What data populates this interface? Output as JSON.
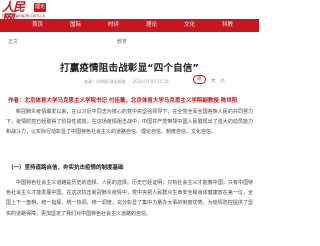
{
  "site": {
    "logo_text": "人民网",
    "logo_domain": "theory.people.com.cn",
    "badge": "理论"
  },
  "nav": {
    "items": [
      "首页",
      "国际",
      "时评",
      "理论",
      "文化",
      "科教"
    ]
  },
  "breadcrumb": {
    "left": "正文",
    "middle": "教育"
  },
  "article": {
    "title": "打赢疫情阻击战彰显“四个自信”",
    "meta_source": "来源：光明网-理论频道",
    "meta_time": "2020-03-05 15:14",
    "listen_label": "听",
    "font_big": "大",
    "font_small": "小",
    "author_line": "作者：北京体育大学马克思主义学院书记 付佳董，北京体育大学马克思主义学院副教授 陈世阳",
    "paragraphs": [
      "新冠肺炎疫情爆发以来，在以习近平同志为核心的党中央坚强领导下，在全党全军全国各族人民的共同努力下，疫情防控已经取得了阶段性成效。在这场疫情阻击战中，中国共产党带领中国人民展现出了强大的动员能力和战斗力，以实际行动彰显了中国特色社会主义的道路自信、理论自信、制度自信、文化自信。",
      "中国特色社会主义道路是历史的选择、人民的选择。历史已经证明，只有社会主义才能救中国，只有中国特色社会主义才能发展中国。在这次抗击新冠肺炎疫情中，党中央把人民群众生命安全和身体健康放在第一位，全国上下一盘棋，统一指挥、统一协调、统一调度，充分彰显了集中力量办大事的制度优势，为疫情防控提供了坚实的道路保障，更加坚定了我们对中国特色社会主义道路的自信。"
    ],
    "heading_1": "（一）坚持道路自信，夯实抗击疫情的制度基础"
  }
}
